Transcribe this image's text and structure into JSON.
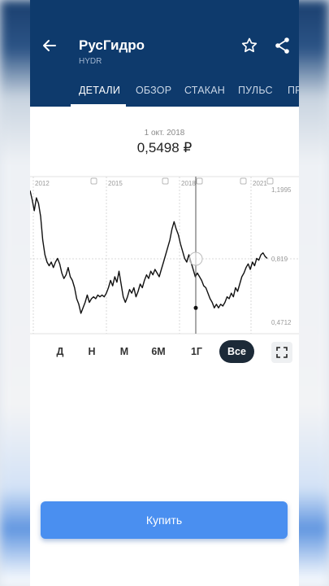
{
  "header": {
    "title": "РусГидро",
    "ticker": "HYDR",
    "background_color": "#0e3a6c"
  },
  "icons": {
    "back": "arrow-left-icon",
    "favorite": "star-icon",
    "share": "share-icon",
    "expand": "expand-icon"
  },
  "tabs": [
    {
      "label": "ДЕТАЛИ",
      "active": true
    },
    {
      "label": "ОБЗОР",
      "active": false
    },
    {
      "label": "СТАКАН",
      "active": false
    },
    {
      "label": "ПУЛЬС",
      "active": false
    },
    {
      "label": "ПР",
      "active": false
    }
  ],
  "quote": {
    "date": "1 окт. 2018",
    "price": "0,5498 ₽"
  },
  "chart_data": {
    "type": "line",
    "ylim": [
      0.4712,
      1.1995
    ],
    "y_labels": [
      "1,1995",
      "0,819",
      "0,4712"
    ],
    "x_labels": [
      "2012",
      "2015",
      "2018",
      "2021"
    ],
    "grid": true,
    "series": [
      {
        "values": [
          1.19,
          1.14,
          1.08,
          1.15,
          1.12,
          1.05,
          0.92,
          0.84,
          0.8,
          0.78,
          0.8,
          0.77,
          0.8,
          0.82,
          0.79,
          0.74,
          0.71,
          0.73,
          0.77,
          0.72,
          0.7,
          0.66,
          0.6,
          0.57,
          0.52,
          0.55,
          0.58,
          0.62,
          0.58,
          0.6,
          0.61,
          0.6,
          0.62,
          0.61,
          0.62,
          0.61,
          0.63,
          0.66,
          0.7,
          0.67,
          0.72,
          0.69,
          0.75,
          0.68,
          0.61,
          0.58,
          0.61,
          0.65,
          0.63,
          0.66,
          0.61,
          0.64,
          0.68,
          0.66,
          0.7,
          0.73,
          0.71,
          0.75,
          0.73,
          0.76,
          0.74,
          0.72,
          0.76,
          0.8,
          0.84,
          0.88,
          0.92,
          0.98,
          1.02,
          0.98,
          0.95,
          0.9,
          0.86,
          0.82,
          0.8,
          0.84,
          0.8,
          0.76,
          0.72,
          0.74,
          0.72,
          0.7,
          0.67,
          0.66,
          0.63,
          0.6,
          0.58,
          0.55,
          0.57,
          0.55,
          0.57,
          0.56,
          0.58,
          0.61,
          0.6,
          0.63,
          0.61,
          0.66,
          0.64,
          0.68,
          0.72,
          0.74,
          0.77,
          0.79,
          0.76,
          0.8,
          0.78,
          0.82,
          0.81,
          0.84,
          0.85,
          0.83,
          0.82
        ]
      }
    ],
    "crosshair": {
      "date": "1 окт. 2018",
      "value": 0.5498
    }
  },
  "ranges": [
    {
      "label": "Д",
      "active": false
    },
    {
      "label": "Н",
      "active": false
    },
    {
      "label": "М",
      "active": false
    },
    {
      "label": "6М",
      "active": false
    },
    {
      "label": "1Г",
      "active": false
    },
    {
      "label": "Все",
      "active": true
    }
  ],
  "buy_label": "Купить",
  "colors": {
    "accent": "#4a8ff0",
    "active_range": "#1c2a38"
  }
}
